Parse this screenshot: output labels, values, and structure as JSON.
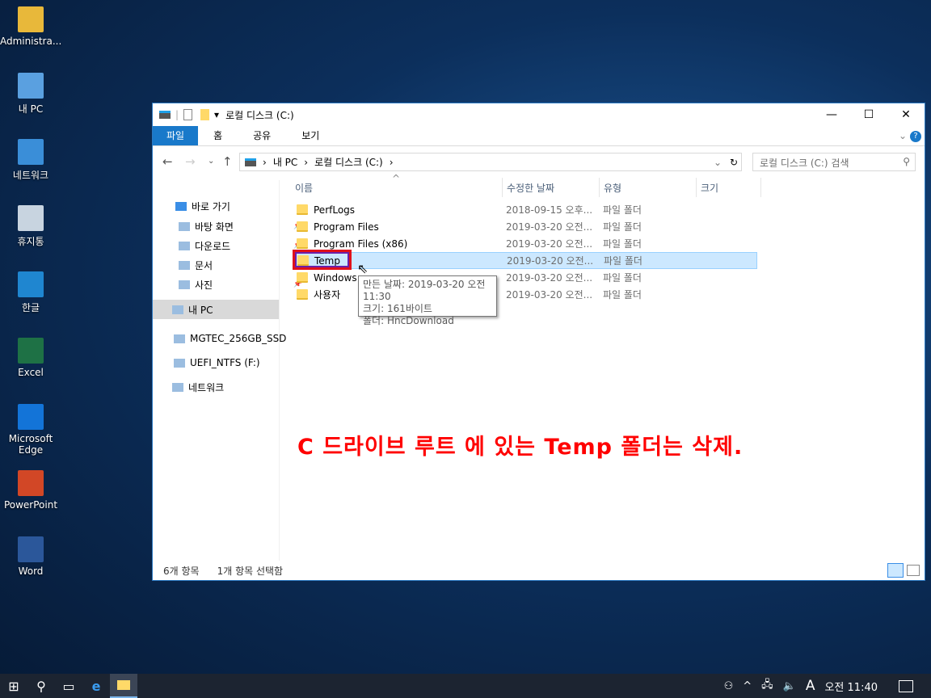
{
  "desktop": {
    "icons": [
      {
        "label": "Administra...",
        "color": "#e8b83a"
      },
      {
        "label": "내 PC",
        "color": "#5aa0e0"
      },
      {
        "label": "네트워크",
        "color": "#3a8ed8"
      },
      {
        "label": "휴지통",
        "color": "#c8d4e0"
      },
      {
        "label": "한글",
        "color": "#1f86d0"
      },
      {
        "label": "Excel",
        "color": "#1e7145"
      },
      {
        "label": "Microsoft Edge",
        "color": "#1374d8"
      },
      {
        "label": "PowerPoint",
        "color": "#d24726"
      },
      {
        "label": "Word",
        "color": "#2b579a"
      }
    ]
  },
  "window": {
    "title": "로컬 디스크 (C:)",
    "ribbon_tabs": [
      "파일",
      "홈",
      "공유",
      "보기"
    ],
    "breadcrumb": [
      "내 PC",
      "로컬 디스크 (C:)"
    ],
    "search_placeholder": "로컬 디스크 (C:) 검색",
    "nav": [
      {
        "label": "바로 가기"
      },
      {
        "label": "바탕 화면",
        "pinned": true
      },
      {
        "label": "다운로드",
        "pinned": true
      },
      {
        "label": "문서",
        "pinned": true
      },
      {
        "label": "사진",
        "pinned": true
      },
      {
        "label": "내 PC",
        "selected": true
      },
      {
        "label": "MGTEC_256GB_SSD"
      },
      {
        "label": "UEFI_NTFS (F:)"
      },
      {
        "label": "네트워크"
      }
    ],
    "columns": [
      "이름",
      "수정한 날짜",
      "유형",
      "크기"
    ],
    "files": [
      {
        "name": "PerfLogs",
        "date": "2018-09-15 오후...",
        "type": "파일 폴더"
      },
      {
        "name": "Program Files",
        "date": "2019-03-20 오전...",
        "type": "파일 폴더"
      },
      {
        "name": "Program Files (x86)",
        "date": "2019-03-20 오전...",
        "type": "파일 폴더"
      },
      {
        "name": "Temp",
        "date": "2019-03-20 오전...",
        "type": "파일 폴더",
        "selected": true
      },
      {
        "name": "Windows",
        "date": "2019-03-20 오전...",
        "type": "파일 폴더"
      },
      {
        "name": "사용자",
        "date": "2019-03-20 오전...",
        "type": "파일 폴더"
      }
    ],
    "tooltip": [
      "만든 날짜: 2019-03-20 오전 11:30",
      "크기: 161바이트",
      "폴더: HncDownload"
    ],
    "status": {
      "count": "6개 항목",
      "selected": "1개 항목 선택함"
    }
  },
  "annotation": {
    "text": "C 드라이브 루트 에 있는 Temp 폴더는 삭제.",
    "color": "#ff0000"
  },
  "taskbar": {
    "ime": "A",
    "clock": "오전 11:40"
  }
}
